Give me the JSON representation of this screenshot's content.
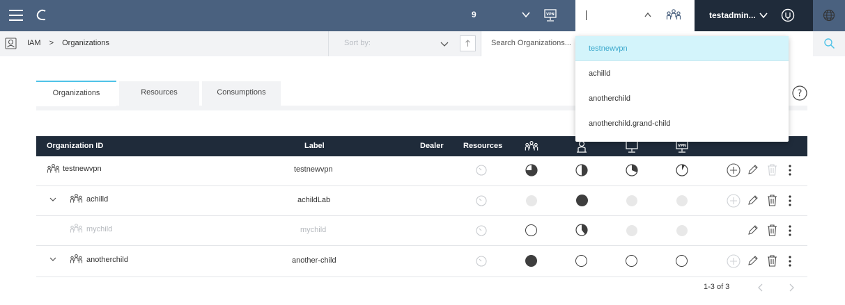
{
  "topbar": {
    "org_count": "9",
    "username": "testadmin...",
    "org_input_value": ""
  },
  "breadcrumb": {
    "root": "IAM",
    "separator": ">",
    "current": "Organizations"
  },
  "sort": {
    "placeholder": "Sort by:"
  },
  "search": {
    "placeholder": "Search Organizations..."
  },
  "tabs": [
    {
      "label": "Organizations",
      "active": true
    },
    {
      "label": "Resources",
      "active": false
    },
    {
      "label": "Consumptions",
      "active": false
    }
  ],
  "table": {
    "headers": {
      "org_id": "Organization ID",
      "label": "Label",
      "dealer": "Dealer",
      "resources": "Resources"
    },
    "rows": [
      {
        "org_id": "testnewvpn",
        "label": "testnewvpn",
        "expandable": false,
        "indent": 0,
        "dimmed": false,
        "usage": [
          "pie-high",
          "pie-half",
          "pie-low",
          "pie-tiny"
        ],
        "actions": [
          "add",
          "edit",
          "delete-disabled",
          "more"
        ]
      },
      {
        "org_id": "achilld",
        "label": "achildLab",
        "expandable": true,
        "indent": 1,
        "dimmed": false,
        "usage": [
          "grey",
          "full",
          "grey",
          "grey"
        ],
        "actions": [
          "add-disabled",
          "edit",
          "delete",
          "more"
        ]
      },
      {
        "org_id": "mychild",
        "label": "mychild",
        "expandable": false,
        "indent": 2,
        "dimmed": true,
        "usage": [
          "empty",
          "pie-med",
          "grey",
          "grey"
        ],
        "actions": [
          "edit",
          "delete",
          "more"
        ]
      },
      {
        "org_id": "anotherchild",
        "label": "another-child",
        "expandable": true,
        "indent": 1,
        "dimmed": false,
        "usage": [
          "full",
          "empty",
          "empty",
          "empty"
        ],
        "actions": [
          "add-disabled",
          "edit",
          "delete",
          "more"
        ]
      }
    ]
  },
  "pagination": {
    "text": "1-3 of 3"
  },
  "dropdown": {
    "items": [
      "testnewvpn",
      "achilld",
      "anotherchild",
      "anotherchild.grand-child"
    ],
    "selected_index": 0
  },
  "colors": {
    "topbar": "#4a617f",
    "dark": "#1f2b3a",
    "accent": "#4fc3e8",
    "selected_bg": "#d3f4fb"
  }
}
